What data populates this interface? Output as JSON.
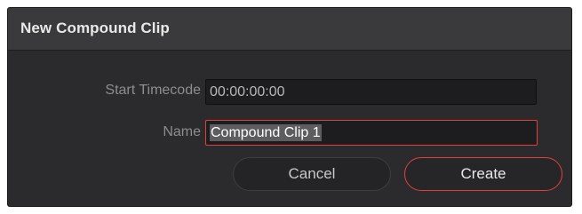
{
  "dialog": {
    "title": "New Compound Clip",
    "start_timecode": {
      "label": "Start Timecode",
      "value": "00:00:00:00"
    },
    "name": {
      "label": "Name",
      "value": "Compound Clip 1"
    },
    "buttons": {
      "cancel": "Cancel",
      "create": "Create"
    }
  },
  "colors": {
    "accent": "#e0413b",
    "panel": "#2b2b2d",
    "titlebar": "#3a3a3c",
    "field_bg": "#1d1d1f"
  }
}
